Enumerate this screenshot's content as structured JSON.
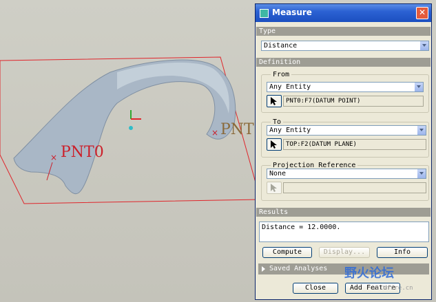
{
  "viewport": {
    "point_label_1": "PNT0",
    "point_label_2": "PNT"
  },
  "dialog": {
    "title": "Measure",
    "type_section": "Type",
    "type_value": "Distance",
    "definition_section": "Definition",
    "from_group": "From",
    "from_filter": "Any Entity",
    "from_selection": "PNT0:F7(DATUM POINT)",
    "to_group": "To",
    "to_filter": "Any Entity",
    "to_selection": "TOP:F2(DATUM PLANE)",
    "projection_group": "Projection Reference",
    "projection_filter": "None",
    "projection_selection": "",
    "results_section": "Results",
    "results_text": "Distance = 12.0000.",
    "compute_label": "Compute",
    "display_label": "Display...",
    "info_label": "Info",
    "saved_analyses_label": "Saved Analyses",
    "close_label": "Close",
    "add_feature_label": "Add Feature"
  },
  "watermark": {
    "text": "野火论坛",
    "subtext": "wildfire.cn"
  },
  "colors": {
    "title_bar": "#2c62d3",
    "dialog_bg": "#ece9d8",
    "section_bar": "#9e9d94",
    "datum_plane": "#e0242a",
    "surface": "#a7b5c3"
  }
}
